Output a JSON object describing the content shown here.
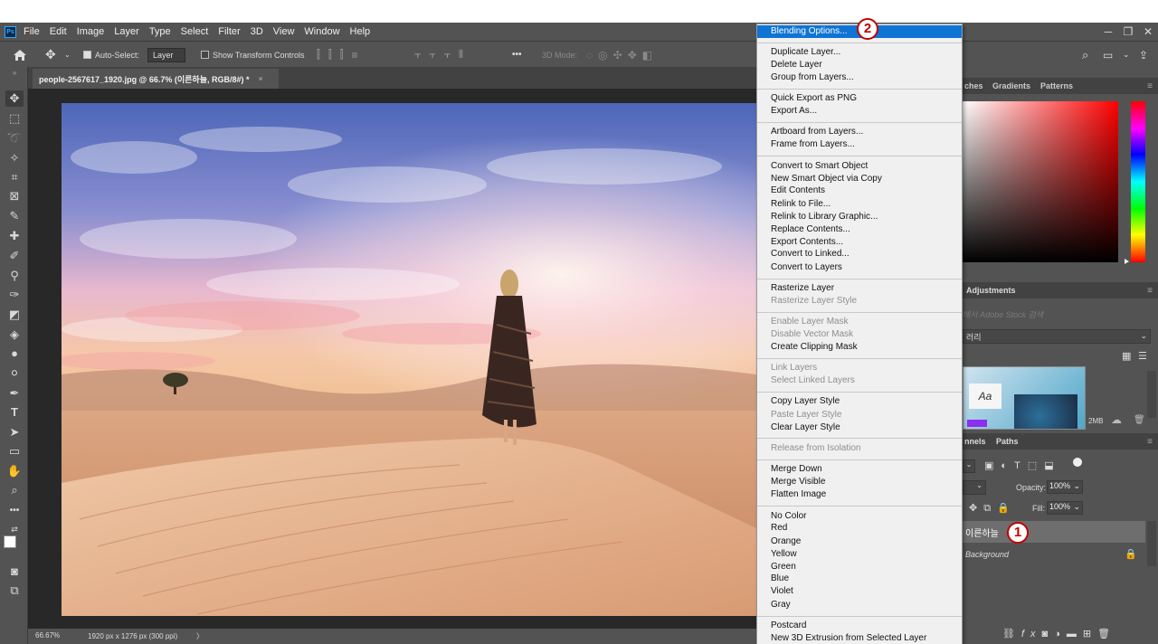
{
  "menubar": {
    "items": [
      "File",
      "Edit",
      "Image",
      "Layer",
      "Type",
      "Select",
      "Filter",
      "3D",
      "View",
      "Window",
      "Help"
    ]
  },
  "options": {
    "auto_select_label": "Auto-Select:",
    "auto_select_value": "Layer",
    "show_transform_label": "Show Transform Controls",
    "more_label": "•••",
    "mode_3d_label": "3D Mode:"
  },
  "document": {
    "tab_title": "people-2567617_1920.jpg @ 66.7% (이른하늘, RGB/8#) *",
    "close_glyph": "×"
  },
  "status": {
    "zoom": "66.67%",
    "dimensions": "1920 px x 1276 px (300 ppi)",
    "arrow": "〉"
  },
  "panels": {
    "tab_swatches": "ches",
    "tab_gradients": "Gradients",
    "tab_patterns": "Patterns",
    "adjustments": "Adjustments",
    "stock_search": "에서 Adobe Stock 검색",
    "library_name": "러리",
    "library_size": "2MB",
    "layers_tab_channels": "nnels",
    "layers_tab_paths": "Paths",
    "opacity_label": "Opacity:",
    "opacity_value": "100%",
    "fill_label": "Fill:",
    "fill_value": "100%",
    "layer_selected": "이른하늘",
    "layer_background": "Background"
  },
  "context_menu": {
    "items": [
      {
        "label": "Blending Options...",
        "state": "highlighted"
      },
      {
        "label": "Duplicate Layer...",
        "state": "enabled"
      },
      {
        "label": "Delete Layer",
        "state": "enabled"
      },
      {
        "label": "Group from Layers...",
        "state": "enabled"
      },
      {
        "label": "Quick Export as PNG",
        "state": "enabled"
      },
      {
        "label": "Export As...",
        "state": "enabled"
      },
      {
        "label": "Artboard from Layers...",
        "state": "enabled"
      },
      {
        "label": "Frame from Layers...",
        "state": "enabled"
      },
      {
        "label": "Convert to Smart Object",
        "state": "enabled"
      },
      {
        "label": "New Smart Object via Copy",
        "state": "enabled"
      },
      {
        "label": "Edit Contents",
        "state": "enabled"
      },
      {
        "label": "Relink to File...",
        "state": "enabled"
      },
      {
        "label": "Relink to Library Graphic...",
        "state": "enabled"
      },
      {
        "label": "Replace Contents...",
        "state": "enabled"
      },
      {
        "label": "Export Contents...",
        "state": "enabled"
      },
      {
        "label": "Convert to Linked...",
        "state": "enabled"
      },
      {
        "label": "Convert to Layers",
        "state": "enabled"
      },
      {
        "label": "Rasterize Layer",
        "state": "enabled"
      },
      {
        "label": "Rasterize Layer Style",
        "state": "disabled"
      },
      {
        "label": "Enable Layer Mask",
        "state": "disabled"
      },
      {
        "label": "Disable Vector Mask",
        "state": "disabled"
      },
      {
        "label": "Create Clipping Mask",
        "state": "enabled"
      },
      {
        "label": "Link Layers",
        "state": "disabled"
      },
      {
        "label": "Select Linked Layers",
        "state": "disabled"
      },
      {
        "label": "Copy Layer Style",
        "state": "enabled"
      },
      {
        "label": "Paste Layer Style",
        "state": "disabled"
      },
      {
        "label": "Clear Layer Style",
        "state": "enabled"
      },
      {
        "label": "Release from Isolation",
        "state": "disabled"
      },
      {
        "label": "Merge Down",
        "state": "enabled"
      },
      {
        "label": "Merge Visible",
        "state": "enabled"
      },
      {
        "label": "Flatten Image",
        "state": "enabled"
      },
      {
        "label": "No Color",
        "state": "enabled"
      },
      {
        "label": "Red",
        "state": "enabled"
      },
      {
        "label": "Orange",
        "state": "enabled"
      },
      {
        "label": "Yellow",
        "state": "enabled"
      },
      {
        "label": "Green",
        "state": "enabled"
      },
      {
        "label": "Blue",
        "state": "enabled"
      },
      {
        "label": "Violet",
        "state": "enabled"
      },
      {
        "label": "Gray",
        "state": "enabled"
      },
      {
        "label": "Postcard",
        "state": "enabled"
      },
      {
        "label": "New 3D Extrusion from Selected Layer",
        "state": "enabled"
      }
    ]
  },
  "callouts": {
    "one": "1",
    "two": "2"
  },
  "colors": {
    "menu_highlight": "#0f74d4",
    "callout_red": "#c00000"
  }
}
